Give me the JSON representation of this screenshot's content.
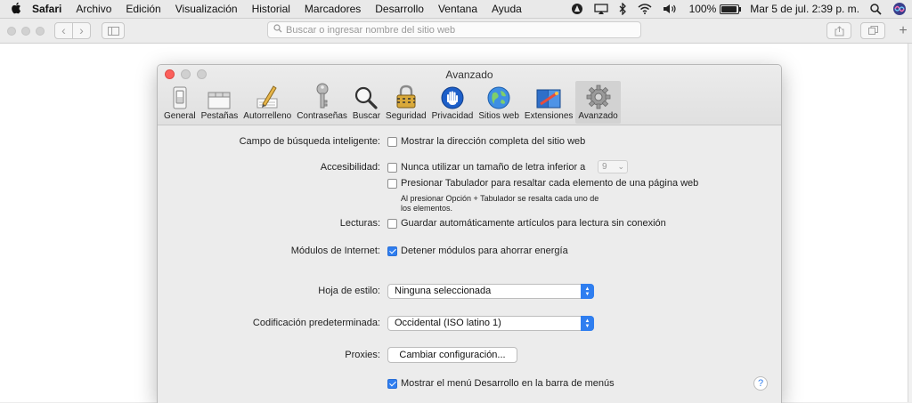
{
  "menubar": {
    "app": "Safari",
    "items": [
      "Archivo",
      "Edición",
      "Visualización",
      "Historial",
      "Marcadores",
      "Desarrollo",
      "Ventana",
      "Ayuda"
    ],
    "battery_text": "100%",
    "battery_level": 1.0,
    "date_time": "Mar 5 de jul.  2:39 p. m."
  },
  "toolbar": {
    "url_placeholder": "Buscar o ingresar nombre del sitio web"
  },
  "prefs": {
    "title": "Avanzado",
    "tabs": [
      {
        "label": "General",
        "icon": "general-switch-icon"
      },
      {
        "label": "Pestañas",
        "icon": "tabs-icon"
      },
      {
        "label": "Autorrelleno",
        "icon": "autofill-pencil-icon"
      },
      {
        "label": "Contraseñas",
        "icon": "key-icon"
      },
      {
        "label": "Buscar",
        "icon": "magnifier-icon"
      },
      {
        "label": "Seguridad",
        "icon": "padlock-icon"
      },
      {
        "label": "Privacidad",
        "icon": "hand-icon"
      },
      {
        "label": "Sitios web",
        "icon": "globe-icon"
      },
      {
        "label": "Extensiones",
        "icon": "puzzle-icon"
      },
      {
        "label": "Avanzado",
        "icon": "gear-icon"
      }
    ],
    "smart_search_label": "Campo de búsqueda inteligente:",
    "smart_search_option": "Mostrar la dirección completa del sitio web",
    "accessibility_label": "Accesibilidad:",
    "accessibility_option1": "Nunca utilizar un tamaño de letra inferior a",
    "font_size_value": "9",
    "accessibility_option2": "Presionar Tabulador para resaltar cada elemento de una página web",
    "accessibility_note_line1": "Al presionar Opción + Tabulador se resalta cada uno de",
    "accessibility_note_line2": "los elementos.",
    "reading_label": "Lecturas:",
    "reading_option": "Guardar automáticamente artículos para lectura sin conexión",
    "plugins_label": "Módulos de Internet:",
    "plugins_option": "Detener módulos para ahorrar energía",
    "stylesheet_label": "Hoja de estilo:",
    "stylesheet_value": "Ninguna seleccionada",
    "encoding_label": "Codificación predeterminada:",
    "encoding_value": "Occidental (ISO latino 1)",
    "proxies_label": "Proxies:",
    "proxies_button": "Cambiar configuración...",
    "develop_menu_option": "Mostrar el menú Desarrollo en la barra de menús",
    "help_glyph": "?"
  }
}
